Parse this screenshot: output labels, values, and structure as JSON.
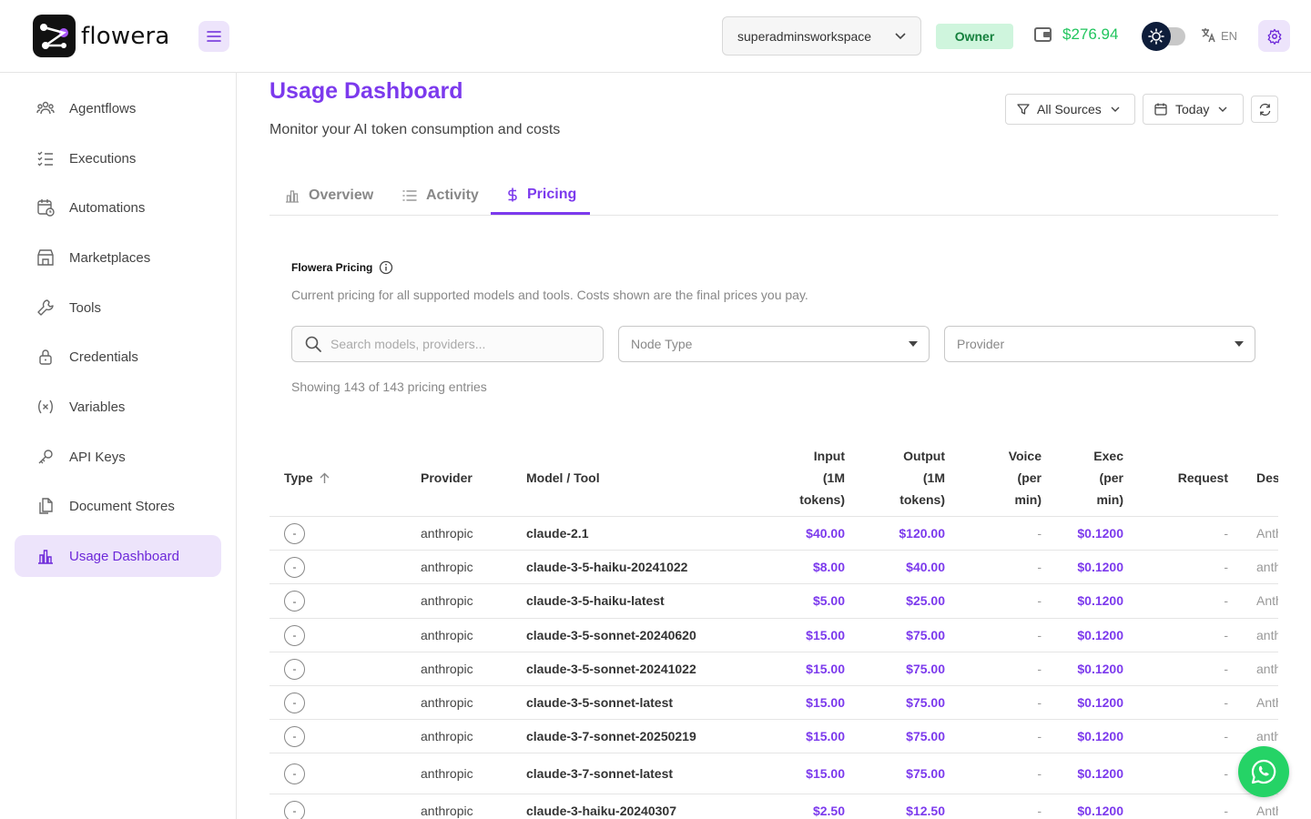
{
  "header": {
    "logo_text": "flowera",
    "workspace": "superadminsworkspace",
    "role": "Owner",
    "balance": "$276.94",
    "language": "EN"
  },
  "sidebar": {
    "items": [
      {
        "label": "Agentflows",
        "icon": "agents-icon",
        "active": false
      },
      {
        "label": "Executions",
        "icon": "list-check-icon",
        "active": false
      },
      {
        "label": "Automations",
        "icon": "calendar-clock-icon",
        "active": false
      },
      {
        "label": "Marketplaces",
        "icon": "store-icon",
        "active": false
      },
      {
        "label": "Tools",
        "icon": "tool-icon",
        "active": false
      },
      {
        "label": "Credentials",
        "icon": "lock-icon",
        "active": false
      },
      {
        "label": "Variables",
        "icon": "variable-icon",
        "active": false
      },
      {
        "label": "API Keys",
        "icon": "key-icon",
        "active": false
      },
      {
        "label": "Document Stores",
        "icon": "files-icon",
        "active": false
      },
      {
        "label": "Usage Dashboard",
        "icon": "chart-bar-icon",
        "active": true
      }
    ]
  },
  "page": {
    "title": "Usage Dashboard",
    "subtitle": "Monitor your AI token consumption and costs",
    "source_filter": "All Sources",
    "date_filter": "Today"
  },
  "tabs": [
    {
      "label": "Overview",
      "active": false
    },
    {
      "label": "Activity",
      "active": false
    },
    {
      "label": "Pricing",
      "active": true
    }
  ],
  "pricing": {
    "heading": "Flowera Pricing",
    "description": "Current pricing for all supported models and tools. Costs shown are the final prices you pay.",
    "search_placeholder": "Search models, providers...",
    "node_type_placeholder": "Node Type",
    "provider_placeholder": "Provider",
    "showing": "Showing 143 of 143 pricing entries"
  },
  "table": {
    "headers": {
      "type": "Type",
      "provider": "Provider",
      "model": "Model / Tool",
      "input": [
        "Input",
        "(1M",
        "tokens)"
      ],
      "output": [
        "Output",
        "(1M",
        "tokens)"
      ],
      "voice": [
        "Voice",
        "(per",
        "min)"
      ],
      "exec": [
        "Exec",
        "(per",
        "min)"
      ],
      "request": "Request",
      "description": "Des"
    },
    "rows": [
      {
        "type": "-",
        "provider": "anthropic",
        "model": "claude-2.1",
        "input": "$40.00",
        "output": "$120.00",
        "voice": "-",
        "exec": "$0.1200",
        "request": "-",
        "description": "Anth"
      },
      {
        "type": "-",
        "provider": "anthropic",
        "model": "claude-3-5-haiku-20241022",
        "input": "$8.00",
        "output": "$40.00",
        "voice": "-",
        "exec": "$0.1200",
        "request": "-",
        "description": "anth"
      },
      {
        "type": "-",
        "provider": "anthropic",
        "model": "claude-3-5-haiku-latest",
        "input": "$5.00",
        "output": "$25.00",
        "voice": "-",
        "exec": "$0.1200",
        "request": "-",
        "description": "Anth"
      },
      {
        "type": "-",
        "provider": "anthropic",
        "model": "claude-3-5-sonnet-20240620",
        "input": "$15.00",
        "output": "$75.00",
        "voice": "-",
        "exec": "$0.1200",
        "request": "-",
        "description": "anth"
      },
      {
        "type": "-",
        "provider": "anthropic",
        "model": "claude-3-5-sonnet-20241022",
        "input": "$15.00",
        "output": "$75.00",
        "voice": "-",
        "exec": "$0.1200",
        "request": "-",
        "description": "anth"
      },
      {
        "type": "-",
        "provider": "anthropic",
        "model": "claude-3-5-sonnet-latest",
        "input": "$15.00",
        "output": "$75.00",
        "voice": "-",
        "exec": "$0.1200",
        "request": "-",
        "description": "Anth"
      },
      {
        "type": "-",
        "provider": "anthropic",
        "model": "claude-3-7-sonnet-20250219",
        "input": "$15.00",
        "output": "$75.00",
        "voice": "-",
        "exec": "$0.1200",
        "request": "-",
        "description": "anth"
      },
      {
        "type": "-",
        "provider": "anthropic",
        "model": "claude-3-7-sonnet-latest",
        "input": "$15.00",
        "output": "$75.00",
        "voice": "-",
        "exec": "$0.1200",
        "request": "-",
        "description": "Anth"
      },
      {
        "type": "-",
        "provider": "anthropic",
        "model": "claude-3-haiku-20240307",
        "input": "$2.50",
        "output": "$12.50",
        "voice": "-",
        "exec": "$0.1200",
        "request": "-",
        "description": "Anth"
      }
    ]
  },
  "colors": {
    "accent": "#7c3aed",
    "active_bg": "#ede4fb",
    "balance": "#22c55e",
    "owner_bg": "#cff5dd",
    "whatsapp": "#25d366"
  }
}
